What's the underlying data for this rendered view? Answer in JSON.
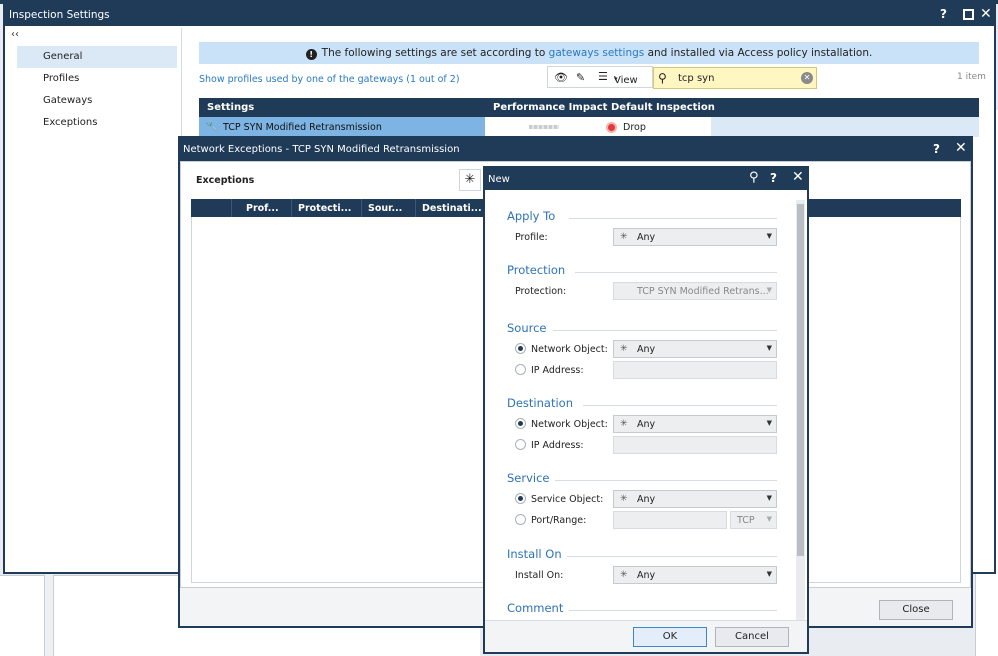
{
  "inspection_window": {
    "title": "Inspection Settings",
    "collapse_label": "‹‹",
    "nav": [
      {
        "label": "General",
        "active": true
      },
      {
        "label": "Profiles",
        "active": false
      },
      {
        "label": "Gateways",
        "active": false
      },
      {
        "label": "Exceptions",
        "active": false
      }
    ],
    "banner": {
      "text_before": "The following settings are set according to ",
      "link": "gateways settings",
      "text_after": " and installed via Access policy installation."
    },
    "show_profiles_link": "Show profiles used by one of the gateways (1 out of 2)",
    "toolbar": {
      "view_label": "View"
    },
    "search_value": "tcp syn",
    "item_count": "1 item",
    "table": {
      "columns": [
        "Settings",
        "Performance Impact",
        "Default Inspection"
      ],
      "rows": [
        {
          "setting": "TCP SYN Modified Retransmission",
          "performance_impact": "",
          "default_inspection": "Drop"
        }
      ]
    }
  },
  "exceptions_window": {
    "title": "Network Exceptions - TCP SYN Modified Retransmission",
    "section_label": "Exceptions",
    "columns": [
      "Prof...",
      "Protecti...",
      "Sour...",
      "Destinati..."
    ],
    "close_label": "Close"
  },
  "new_dialog": {
    "title": "New",
    "sections": {
      "apply_to": "Apply To",
      "protection": "Protection",
      "source": "Source",
      "destination": "Destination",
      "service": "Service",
      "install_on": "Install On",
      "comment": "Comment"
    },
    "fields": {
      "profile_label": "Profile:",
      "profile_value": "Any",
      "protection_label": "Protection:",
      "protection_value": "TCP SYN Modified Retrans...",
      "src_network_label": "Network Object:",
      "src_network_value": "Any",
      "src_ip_label": "IP Address:",
      "dst_network_label": "Network Object:",
      "dst_network_value": "Any",
      "dst_ip_label": "IP Address:",
      "service_object_label": "Service Object:",
      "service_object_value": "Any",
      "port_range_label": "Port/Range:",
      "port_protocol_value": "TCP",
      "install_on_label": "Install On:",
      "install_on_value": "Any"
    },
    "ok_label": "OK",
    "cancel_label": "Cancel"
  },
  "colors": {
    "titlebar": "#1f3b57",
    "accent": "#2e73b8",
    "banner": "#c9e2f8",
    "search_bg": "#fff6c2"
  }
}
